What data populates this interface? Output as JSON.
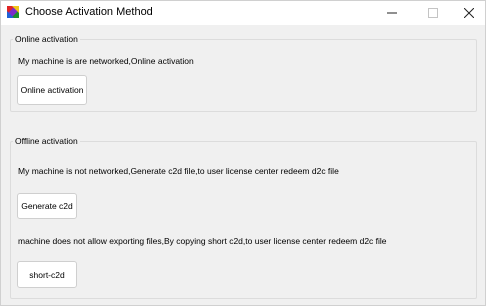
{
  "window": {
    "title": "Choose Activation Method"
  },
  "online": {
    "group_label": "Online activation",
    "description": "My machine is are networked,Online activation",
    "button_label": "Online activation"
  },
  "offline": {
    "group_label": "Offline activation",
    "description_c2d": "My machine is not networked,Generate c2d file,to user license center redeem d2c file",
    "generate_button_label": "Generate c2d",
    "description_short": "machine does not allow exporting files,By copying short c2d,to user license center redeem d2c file",
    "short_button_label": "short-c2d"
  },
  "icons": {
    "app": "app-logo-icon",
    "minimize": "minimize-icon",
    "maximize": "maximize-icon",
    "close": "close-icon"
  }
}
